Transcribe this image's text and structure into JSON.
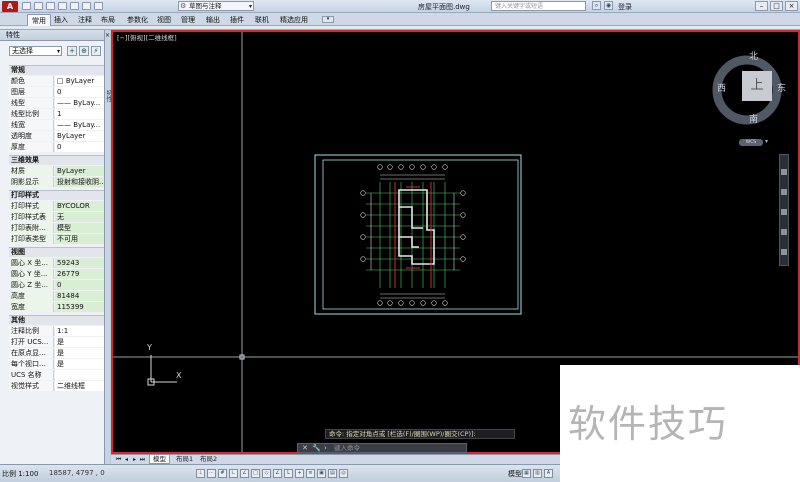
{
  "titlebar": {
    "workspace": "草图与注释",
    "document_title": "房屋平面图.dwg",
    "search_placeholder": "键入关键字或短语",
    "login": "登录"
  },
  "ribbon_tabs": [
    "常用",
    "插入",
    "注释",
    "布局",
    "参数化",
    "视图",
    "管理",
    "输出",
    "插件",
    "联机",
    "精选应用"
  ],
  "active_tab": "常用",
  "properties": {
    "title": "特性",
    "selection": "无选择",
    "sections": [
      {
        "title": "常规",
        "rows": [
          {
            "key": "颜色",
            "value": "□ ByLayer"
          },
          {
            "key": "图层",
            "value": "0"
          },
          {
            "key": "线型",
            "value": "—— ByLay..."
          },
          {
            "key": "线型比例",
            "value": "1"
          },
          {
            "key": "线宽",
            "value": "—— ByLay..."
          },
          {
            "key": "透明度",
            "value": "ByLayer"
          },
          {
            "key": "厚度",
            "value": "0"
          }
        ]
      },
      {
        "title": "三维效果",
        "rows": [
          {
            "key": "材质",
            "value": "ByLayer"
          },
          {
            "key": "阴影显示",
            "value": "投射和接收阴..."
          }
        ]
      },
      {
        "title": "打印样式",
        "rows": [
          {
            "key": "打印样式",
            "value": "BYCOLOR"
          },
          {
            "key": "打印样式表",
            "value": "无"
          },
          {
            "key": "打印表附...",
            "value": "模型"
          },
          {
            "key": "打印表类型",
            "value": "不可用"
          }
        ]
      },
      {
        "title": "视图",
        "rows": [
          {
            "key": "圆心 X 坐...",
            "value": "59243"
          },
          {
            "key": "圆心 Y 坐...",
            "value": "26779"
          },
          {
            "key": "圆心 Z 坐...",
            "value": "0"
          },
          {
            "key": "高度",
            "value": "81484"
          },
          {
            "key": "宽度",
            "value": "115399"
          }
        ]
      },
      {
        "title": "其他",
        "rows": [
          {
            "key": "注释比例",
            "value": "1:1"
          },
          {
            "key": "打开 UCS...",
            "value": "是"
          },
          {
            "key": "在原点显...",
            "value": "是"
          },
          {
            "key": "每个视口...",
            "value": "是"
          },
          {
            "key": "UCS 名称",
            "value": ""
          },
          {
            "key": "视觉样式",
            "value": "二维线框"
          }
        ]
      }
    ]
  },
  "drawing": {
    "viewport_label": "[−][俯视][二维线框]",
    "viewcube": {
      "north": "北",
      "south": "南",
      "east": "东",
      "west": "西",
      "face": "上",
      "wcs": "WCS"
    },
    "ucs": {
      "x": "X",
      "y": "Y"
    },
    "command_history": "命令: 指定对角点或 [栏选(F)/圈围(WP)/圈交(CP)]:",
    "command_placeholder": "键入命令"
  },
  "layout_tabs": [
    "模型",
    "布局1",
    "布局2"
  ],
  "statusbar": {
    "scale": "比例 1:100",
    "coords": "18587, 4797 , 0",
    "model": "模型"
  },
  "watermark": "软件技巧"
}
